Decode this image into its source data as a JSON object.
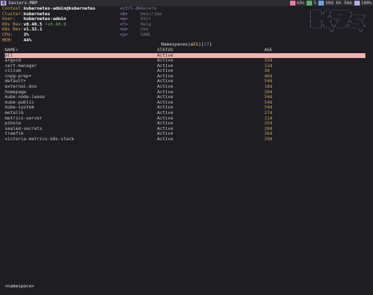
{
  "topbar": {
    "workspace": "Q",
    "hostname": "Xaviers-MBP",
    "status": [
      {
        "label": "k9s",
        "color": "#e87aa3",
        "icon": "app-icon"
      },
      {
        "label": "5",
        "color": "#57b36a",
        "icon": "terminal-icon"
      },
      {
        "label": "30d 6h 56m",
        "color": "#6fa3e8",
        "icon": "clock-icon"
      },
      {
        "label": "100%",
        "color": "#b9a6e8",
        "icon": "battery-icon"
      }
    ]
  },
  "info": {
    "context_key": "Context:",
    "context": "kubernetes-admin@kubernetes",
    "cluster_key": "Cluster:",
    "cluster": "kubernetes",
    "user_key": "User:",
    "user": "kubernetes-admin",
    "k9s_key": "K9s Rev:",
    "k9s_rev": "v0.40.5",
    "k9s_new": "⚡v0.40.8",
    "k8s_key": "K8s Rev:",
    "k8s_rev": "v1.32.1",
    "cpu_key": "CPU:",
    "cpu": "3%",
    "mem_key": "MEM:",
    "mem": "44%"
  },
  "shortcuts": [
    {
      "key": "<ctrl-d>",
      "label": "Delete"
    },
    {
      "key": "<d>",
      "label": "Describe"
    },
    {
      "key": "<e>",
      "label": "Edit"
    },
    {
      "key": "<?>",
      "label": "Help"
    },
    {
      "key": "<u>",
      "label": "Use"
    },
    {
      "key": "<y>",
      "label": "YAML"
    }
  ],
  "logo": " ____  __ ________\n|    |/  /   __   \\______\n|       /\\____    /  ___/\n|    \\   \\  /    /\\___ \\\n|____|\\__ \\/____//____  >\n         \\/           \\/",
  "table": {
    "title": "Namespaces",
    "filter": "all",
    "count": "17",
    "headers": {
      "name": "NAME↑",
      "status": "STATUS",
      "age": "AGE"
    },
    "rows": [
      {
        "name": "all",
        "status": "Active",
        "age": ""
      },
      {
        "name": "argocd",
        "status": "Active",
        "age": "32d"
      },
      {
        "name": "cert-manager",
        "status": "Active",
        "age": "11d"
      },
      {
        "name": "cilium",
        "status": "Active",
        "age": "3d"
      },
      {
        "name": "cnpg-prep+",
        "status": "Active",
        "age": "46d"
      },
      {
        "name": "default+",
        "status": "Active",
        "age": "54d"
      },
      {
        "name": "external-dns",
        "status": "Active",
        "age": "18d"
      },
      {
        "name": "homepage",
        "status": "Active",
        "age": "30d"
      },
      {
        "name": "kube-node-lease",
        "status": "Active",
        "age": "54d"
      },
      {
        "name": "kube-public",
        "status": "Active",
        "age": "54d"
      },
      {
        "name": "kube-system",
        "status": "Active",
        "age": "54d"
      },
      {
        "name": "metallb",
        "status": "Active",
        "age": "27d"
      },
      {
        "name": "metrics-server",
        "status": "Active",
        "age": "11d"
      },
      {
        "name": "pihole",
        "status": "Active",
        "age": "25d"
      },
      {
        "name": "sealed-secrets",
        "status": "Active",
        "age": "20d"
      },
      {
        "name": "traefik",
        "status": "Active",
        "age": "26d"
      },
      {
        "name": "victoria-metrics-k8s-stack",
        "status": "Active",
        "age": "29d"
      }
    ]
  },
  "footer": {
    "crumb": "<namespace>"
  }
}
